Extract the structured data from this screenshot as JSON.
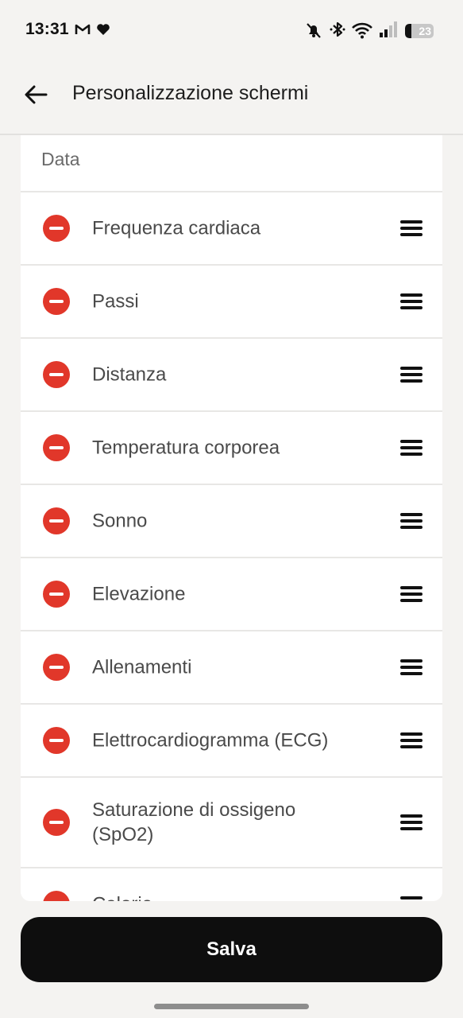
{
  "status_bar": {
    "time": "13:31",
    "battery_level": "23",
    "battery_fraction": 0.23,
    "left_icons": [
      "gmail-icon",
      "heart-icon"
    ],
    "right_icons": [
      "do-not-disturb-icon",
      "bluetooth-icon",
      "wifi-icon",
      "signal-icon",
      "battery-icon"
    ]
  },
  "app_bar": {
    "back_icon": "arrow-left-icon",
    "title": "Personalizzazione schermi"
  },
  "list": {
    "section_header": "Data",
    "items": [
      {
        "label": "Frequenza cardiaca"
      },
      {
        "label": "Passi"
      },
      {
        "label": "Distanza"
      },
      {
        "label": "Temperatura corporea"
      },
      {
        "label": "Sonno"
      },
      {
        "label": "Elevazione"
      },
      {
        "label": "Allenamenti"
      },
      {
        "label": "Elettrocardiogramma (ECG)"
      },
      {
        "label": "Saturazione di ossigeno (SpO2)"
      },
      {
        "label": "Calorie"
      }
    ],
    "remove_icon": "minus-circle-icon",
    "reorder_icon": "drag-handle-icon"
  },
  "footer": {
    "save_label": "Salva"
  },
  "colors": {
    "background": "#f4f3f1",
    "card": "#ffffff",
    "remove_red": "#e1372a",
    "button_black": "#0e0e0e"
  }
}
